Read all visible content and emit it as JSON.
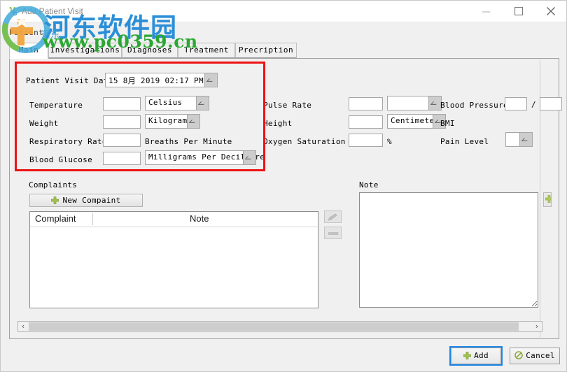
{
  "window": {
    "title": "Add Patient Visit",
    "icon": "app-icon",
    "minimize": "—",
    "maximize": "□",
    "close": "✕"
  },
  "patient_label": "Patient",
  "tabs": [
    {
      "label": "Main",
      "active": true
    },
    {
      "label": "Investigations",
      "active": false
    },
    {
      "label": "Diagnoses",
      "active": false
    },
    {
      "label": "Treatment",
      "active": false
    },
    {
      "label": "Precription",
      "active": false
    }
  ],
  "form": {
    "visit_date": {
      "label": "Patient Visit Date",
      "value": "15 8月 2019 02:17 PM"
    },
    "temperature": {
      "label": "Temperature",
      "value": "",
      "unit": "Celsius"
    },
    "weight": {
      "label": "Weight",
      "value": "",
      "unit": "Kilogram"
    },
    "respiratory_rate": {
      "label": "Respiratory Rate",
      "value": "",
      "unit": "Breaths Per Minute"
    },
    "blood_glucose": {
      "label": "Blood Glucose",
      "value": "",
      "unit": "Milligrams Per Decilitre"
    },
    "pulse_rate": {
      "label": "Pulse Rate",
      "value": "",
      "unit": ""
    },
    "height": {
      "label": "Height",
      "value": "",
      "unit": "Centimeter"
    },
    "oxygen_saturation": {
      "label": "Oxygen Saturation",
      "value": "",
      "unit": "%"
    },
    "blood_pressure": {
      "label": "Blood Pressure",
      "systolic": "",
      "separator": "/",
      "diastolic": ""
    },
    "bmi": {
      "label": "BMI",
      "value": ""
    },
    "pain_level": {
      "label": "Pain Level",
      "value": ""
    }
  },
  "complaints": {
    "section_label": "Complaints",
    "new_button": "New Compaint",
    "columns": [
      "Complaint",
      "Note"
    ],
    "rows": []
  },
  "note": {
    "section_label": "Note",
    "value": ""
  },
  "footer": {
    "add": "Add",
    "cancel": "Cancel"
  },
  "scrollbar": {
    "left_arrow": "‹",
    "right_arrow": "›"
  },
  "watermark": {
    "cn_text": "河东软件园",
    "cn_small": "河东",
    "url": "www.pc0359.cn"
  },
  "colors": {
    "accent": "#1e86e8",
    "annotation": "#ee1111",
    "watermark_blue": "#2b8fd8",
    "watermark_green": "#2aa832",
    "window_bg": "#f0f0f0"
  }
}
